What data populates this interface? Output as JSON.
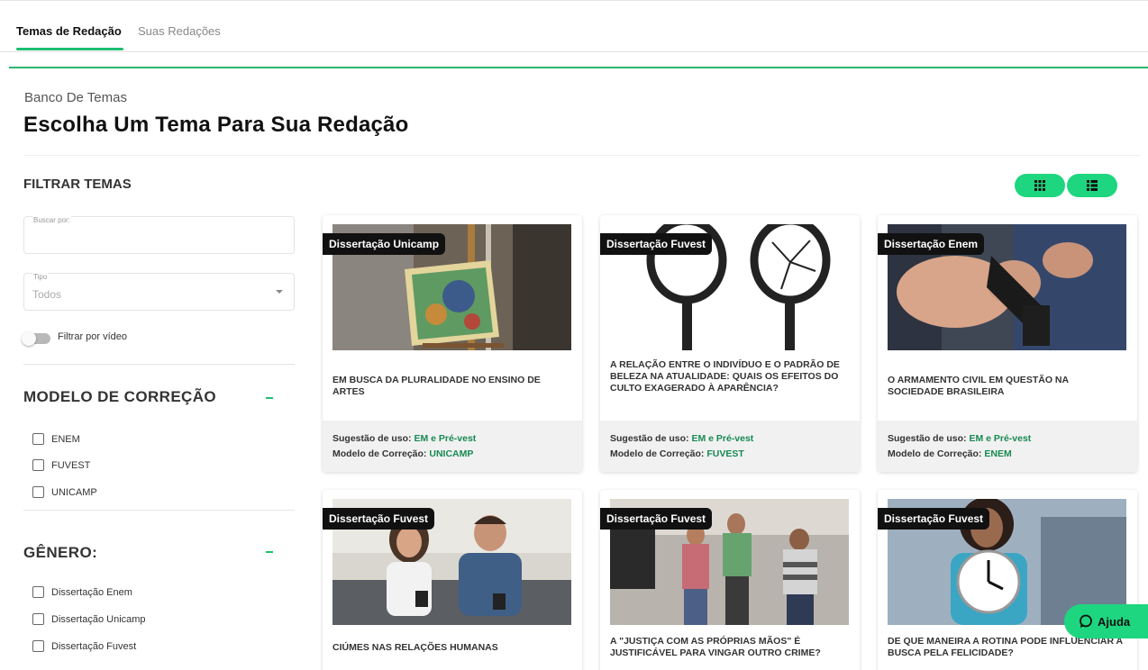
{
  "tabs": [
    {
      "label": "Temas de Redação",
      "active": true
    },
    {
      "label": "Suas Redações",
      "active": false
    }
  ],
  "header": {
    "breadcrumb": "Banco De Temas",
    "title": "Escolha Um Tema Para Sua Redação"
  },
  "filters": {
    "heading": "FILTRAR TEMAS",
    "search": {
      "label": "Buscar por:",
      "value": ""
    },
    "type": {
      "label": "Tipo",
      "value": "Todos"
    },
    "video_toggle": {
      "label": "Filtrar por vídeo",
      "on": false
    }
  },
  "correction_model": {
    "heading": "MODELO DE CORREÇÃO",
    "options": [
      "ENEM",
      "FUVEST",
      "UNICAMP"
    ]
  },
  "genre": {
    "heading": "GÊNERO:",
    "options": [
      "Dissertação Enem",
      "Dissertação Unicamp",
      "Dissertação Fuvest"
    ]
  },
  "cards": [
    {
      "genre": "Dissertação Unicamp",
      "title": "EM BUSCA DA PLURALIDADE NO ENSINO DE ARTES",
      "usage_label": "Sugestão de uso:",
      "usage_value": "EM e Pré-vest",
      "model_label": "Modelo de Correção:",
      "model_value": "UNICAMP",
      "image_icon": "painting-easel-image"
    },
    {
      "genre": "Dissertação Fuvest",
      "title": "A RELAÇÃO ENTRE O INDIVÍDUO E O PADRÃO DE BELEZA NA ATUALIDADE: QUAIS OS EFEITOS DO CULTO EXAGERADO À APARÊNCIA?",
      "usage_label": "Sugestão de uso:",
      "usage_value": "EM e Pré-vest",
      "model_label": "Modelo de Correção:",
      "model_value": "FUVEST",
      "image_icon": "hand-mirrors-image"
    },
    {
      "genre": "Dissertação Enem",
      "title": "O ARMAMENTO CIVIL EM QUESTÃO NA SOCIEDADE BRASILEIRA",
      "usage_label": "Sugestão de uso:",
      "usage_value": "EM e Pré-vest",
      "model_label": "Modelo de Correção:",
      "model_value": "ENEM",
      "image_icon": "handgun-image"
    },
    {
      "genre": "Dissertação Fuvest",
      "title": "CIÚMES NAS RELAÇÕES HUMANAS",
      "image_icon": "couple-phones-image"
    },
    {
      "genre": "Dissertação Fuvest",
      "title": "A \"JUSTIÇA COM AS PRÓPRIAS MÃOS\" É JUSTIFICÁVEL PARA VINGAR OUTRO CRIME?",
      "image_icon": "street-fight-image"
    },
    {
      "genre": "Dissertação Fuvest",
      "title": "DE QUE MANEIRA A ROTINA PODE INFLUENCIAR A BUSCA PELA FELICIDADE?",
      "image_icon": "woman-clock-image"
    }
  ],
  "help": {
    "label": "Ajuda",
    "icon": "chat-bubble-icon"
  },
  "colors": {
    "accent": "#1dd67f",
    "accent_text": "#178a52",
    "rule": "#2fb46e"
  }
}
